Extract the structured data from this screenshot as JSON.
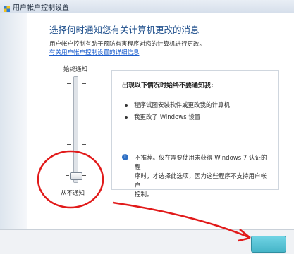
{
  "window": {
    "title": "用户帐户控制设置"
  },
  "main": {
    "heading": "选择何时通知您有关计算机更改的消息",
    "description": "用户帐户控制有助于预防有害程序对您的计算机进行更改。",
    "help_link": "有关用户帐户控制设置的详细信息"
  },
  "slider": {
    "top_label": "始终通知",
    "bottom_label": "从不通知",
    "level": 0
  },
  "info_panel": {
    "title": "出现以下情况时始终不要通知我:",
    "bullets": [
      "程序试图安装软件或更改我的计算机",
      "我更改了 Windows 设置"
    ],
    "note_line1": "不推荐。仅在需要使用未获得 Windows 7 认证的程",
    "note_line2": "序时，才选择此选项，因为这些程序不支持用户帐户",
    "note_line3": "控制。"
  },
  "annotation": {
    "color": "#e11a1a"
  }
}
